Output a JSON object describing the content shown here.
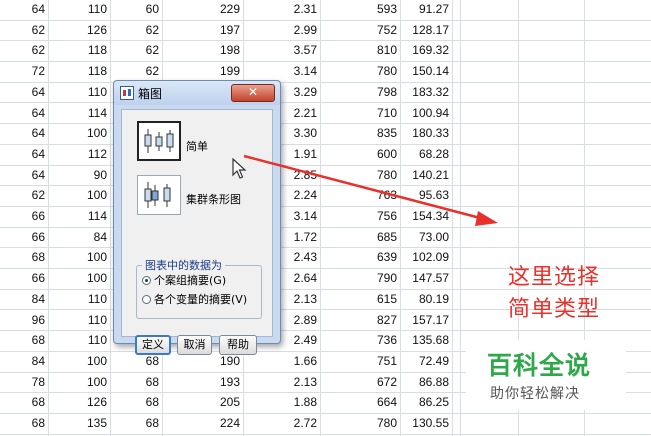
{
  "table": {
    "rows": [
      [
        "64",
        "110",
        "60",
        "229",
        "2.31",
        "593",
        "91.27"
      ],
      [
        "62",
        "126",
        "62",
        "197",
        "2.99",
        "752",
        "128.17"
      ],
      [
        "62",
        "118",
        "62",
        "198",
        "3.57",
        "810",
        "169.32"
      ],
      [
        "72",
        "118",
        "62",
        "199",
        "3.14",
        "780",
        "150.14"
      ],
      [
        "64",
        "110",
        "62",
        "205",
        "3.29",
        "798",
        "183.32"
      ],
      [
        "64",
        "114",
        "",
        "",
        "2.21",
        "710",
        "100.94"
      ],
      [
        "64",
        "100",
        "",
        "",
        "3.30",
        "835",
        "180.33"
      ],
      [
        "64",
        "112",
        "",
        "",
        "1.91",
        "600",
        "68.28"
      ],
      [
        "64",
        "90",
        "",
        "",
        "2.85",
        "780",
        "140.21"
      ],
      [
        "62",
        "100",
        "",
        "",
        "2.24",
        "763",
        "95.63"
      ],
      [
        "66",
        "114",
        "",
        "",
        "3.14",
        "756",
        "154.34"
      ],
      [
        "66",
        "84",
        "",
        "",
        "1.72",
        "685",
        "73.00"
      ],
      [
        "68",
        "100",
        "",
        "",
        "2.43",
        "639",
        "102.09"
      ],
      [
        "66",
        "100",
        "",
        "",
        "2.64",
        "790",
        "147.57"
      ],
      [
        "84",
        "110",
        "",
        "",
        "2.13",
        "615",
        "80.19"
      ],
      [
        "96",
        "110",
        "",
        "",
        "2.89",
        "827",
        "157.17"
      ],
      [
        "68",
        "110",
        "68",
        "188",
        "2.49",
        "736",
        "135.68"
      ],
      [
        "84",
        "100",
        "68",
        "190",
        "1.66",
        "751",
        "72.49"
      ],
      [
        "78",
        "100",
        "68",
        "193",
        "2.13",
        "672",
        "86.88"
      ],
      [
        "68",
        "126",
        "68",
        "205",
        "1.88",
        "664",
        "86.25"
      ],
      [
        "68",
        "135",
        "68",
        "224",
        "2.72",
        "780",
        "130.55"
      ]
    ]
  },
  "dialog": {
    "title": "箱图",
    "close_glyph": "✕",
    "options": [
      {
        "label": "简单",
        "icon": "simple-boxplot-icon"
      },
      {
        "label": "集群条形图",
        "icon": "clustered-boxplot-icon"
      }
    ],
    "group_title": "图表中的数据为",
    "radios": [
      {
        "label": "个案组摘要(G)",
        "checked": true
      },
      {
        "label": "各个变量的摘要(V)",
        "checked": false
      }
    ],
    "buttons": {
      "define": "定义",
      "cancel": "取消",
      "help": "帮助"
    }
  },
  "annotation": {
    "line1": "这里选择",
    "line2": "简单类型"
  },
  "watermark": {
    "main": "百科全说",
    "sub": "助你轻松解决"
  },
  "colors": {
    "annotation": "#e8312a",
    "logo": "#2ea84a",
    "dialog_frame": "#c9daf0"
  }
}
